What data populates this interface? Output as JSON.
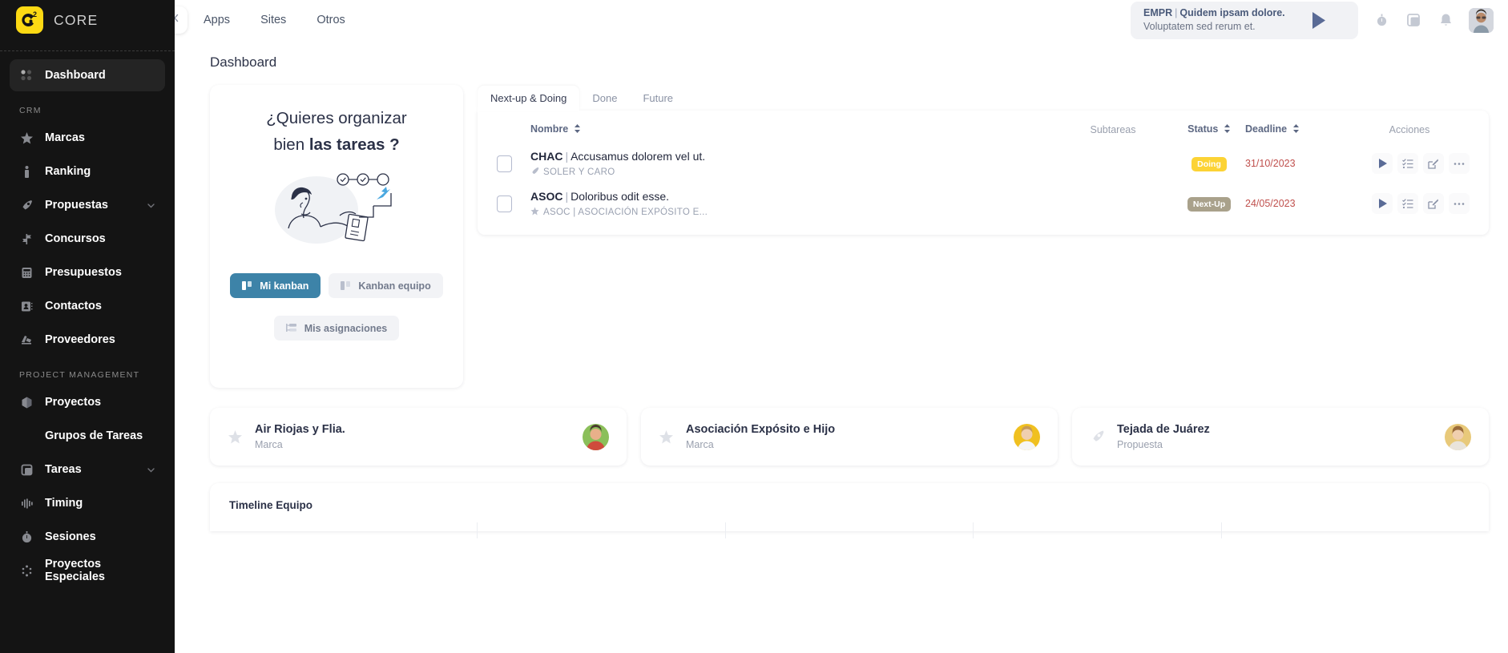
{
  "brand": {
    "name": "CORE"
  },
  "sidebar": {
    "dashboard": {
      "label": "Dashboard",
      "icon": "grid-dots-icon"
    },
    "sections": [
      {
        "label": "CRM",
        "items": [
          {
            "label": "Marcas",
            "icon": "star-icon",
            "chevron": false
          },
          {
            "label": "Ranking",
            "icon": "podium-icon",
            "chevron": false
          },
          {
            "label": "Propuestas",
            "icon": "rocket-icon",
            "chevron": true
          },
          {
            "label": "Concursos",
            "icon": "signpost-icon",
            "chevron": false
          },
          {
            "label": "Presupuestos",
            "icon": "calculator-icon",
            "chevron": false
          },
          {
            "label": "Contactos",
            "icon": "contact-card-icon",
            "chevron": false
          },
          {
            "label": "Proveedores",
            "icon": "truck-icon",
            "chevron": false
          }
        ]
      },
      {
        "label": "PROJECT MANAGEMENT",
        "items": [
          {
            "label": "Proyectos",
            "icon": "cube-icon",
            "chevron": false
          },
          {
            "label": "Grupos de Tareas",
            "icon": "none",
            "chevron": false,
            "sub": true
          },
          {
            "label": "Tareas",
            "icon": "square-icon",
            "chevron": true
          },
          {
            "label": "Timing",
            "icon": "waveform-icon",
            "chevron": false
          },
          {
            "label": "Sesiones",
            "icon": "stopwatch-icon",
            "chevron": false
          },
          {
            "label": "Proyectos Especiales",
            "icon": "sparkle-icon",
            "chevron": false
          }
        ]
      }
    ]
  },
  "topbar": {
    "collapse_icon": "chevron-double-left-icon",
    "nav": [
      {
        "label": "Apps"
      },
      {
        "label": "Sites"
      },
      {
        "label": "Otros"
      }
    ],
    "notice": {
      "code": "EMPR",
      "separator": "|",
      "title": "Quidem ipsam dolore.",
      "subtitle": "Voluptatem sed rerum et.",
      "play_icon": "play-icon"
    },
    "icons": [
      {
        "name": "stopwatch-icon"
      },
      {
        "name": "square-panel-icon"
      },
      {
        "name": "bell-icon"
      }
    ],
    "avatar": {
      "name": "user-avatar"
    }
  },
  "page": {
    "title": "Dashboard"
  },
  "promo": {
    "line1": "¿Quieres organizar",
    "line2_plain": "bien ",
    "line2_bold": "las tareas ?",
    "buttons": [
      {
        "label": "Mi kanban",
        "icon": "kanban-icon",
        "primary": true
      },
      {
        "label": "Kanban equipo",
        "icon": "kanban-icon",
        "primary": false
      },
      {
        "label": "Mis asignaciones",
        "icon": "assignments-icon",
        "primary": false
      }
    ]
  },
  "tasks": {
    "tabs": [
      {
        "label": "Next-up & Doing",
        "active": true
      },
      {
        "label": "Done",
        "active": false
      },
      {
        "label": "Future",
        "active": false
      }
    ],
    "columns": {
      "name": "Nombre",
      "subtasks": "Subtareas",
      "status": "Status",
      "deadline": "Deadline",
      "actions": "Acciones"
    },
    "rows": [
      {
        "code": "CHAC",
        "separator": "|",
        "title": "Accusamus dolorem vel ut.",
        "project_icon": "rocket-icon",
        "project": "SOLER Y CARO",
        "subtasks": "",
        "status": "Doing",
        "status_color": "#FCD335",
        "status_text_color": "#ffffff",
        "deadline": "31/10/2023",
        "actions": [
          "play-icon",
          "list-check-icon",
          "edit-icon",
          "more-icon"
        ]
      },
      {
        "code": "ASOC",
        "separator": "|",
        "title": "Doloribus odit esse.",
        "project_icon": "star-icon",
        "project": "ASOC | ASOCIACIÓN EXPÓSITO E...",
        "subtasks": "",
        "status": "Next-Up",
        "status_color": "#A9A18B",
        "status_text_color": "#ffffff",
        "deadline": "24/05/2023",
        "actions": [
          "play-icon",
          "list-check-icon",
          "edit-icon",
          "more-icon"
        ]
      }
    ]
  },
  "entities": [
    {
      "name": "Air Riojas y Flia.",
      "type": "Marca",
      "icon": "star-icon",
      "avatar_color": "#8bbf5a"
    },
    {
      "name": "Asociación Expósito e Hijo",
      "type": "Marca",
      "icon": "star-icon",
      "avatar_color": "#f0c020"
    },
    {
      "name": "Tejada de Juárez",
      "type": "Propuesta",
      "icon": "rocket-icon",
      "avatar_color": "#e8c97a"
    }
  ],
  "timeline": {
    "title": "Timeline Equipo"
  }
}
